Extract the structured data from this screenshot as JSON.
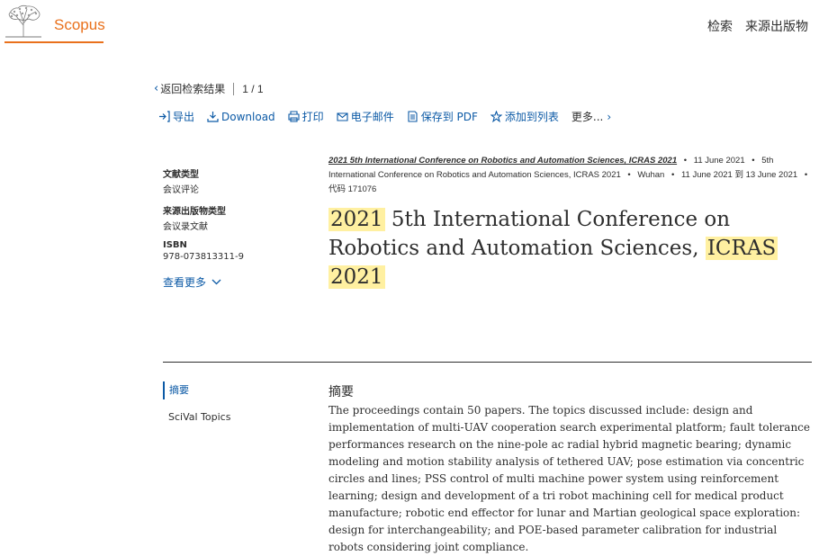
{
  "header": {
    "logo_text": "Scopus",
    "nav": [
      "检索",
      "来源出版物"
    ]
  },
  "colors": {
    "brand": "#e9711c",
    "link": "#0c5aa6",
    "highlight": "#fff0a1"
  },
  "back": {
    "label": "返回检索结果",
    "pager": "1 / 1"
  },
  "toolbar": {
    "export": "导出",
    "download": "Download",
    "print": "打印",
    "email": "电子邮件",
    "save_pdf": "保存到 PDF",
    "add_list": "添加到列表",
    "more": "更多..."
  },
  "meta": {
    "doc_type_label": "文献类型",
    "doc_type_value": "会议评论",
    "source_type_label": "来源出版物类型",
    "source_type_value": "会议录文献",
    "isbn_label": "ISBN",
    "isbn_value": "978-073813311-9",
    "view_more": "查看更多"
  },
  "source": {
    "journal": "2021 5th International Conference on Robotics and Automation Sciences, ICRAS 2021",
    "date": "11 June 2021",
    "conference": "5th International Conference on Robotics and Automation Sciences, ICRAS 2021",
    "location": "Wuhan",
    "date_range": "11 June 2021 到 13 June 2021",
    "code": "代码 171076"
  },
  "title": {
    "part1": "2021",
    "part2": " 5th International Conference on Robotics and Automation Sciences, ",
    "part3": "ICRAS",
    "part4": " ",
    "part5": "2021"
  },
  "sidenav": [
    "摘要",
    "SciVal Topics"
  ],
  "abstract": {
    "heading": "摘要",
    "text": "The proceedings contain 50 papers. The topics discussed include: design and implementation of multi-UAV cooperation search experimental platform; fault tolerance performances research on the nine-pole ac radial hybrid magnetic bearing; dynamic modeling and motion stability analysis of tethered UAV; pose estimation via concentric circles and lines; PSS control of multi machine power system using reinforcement learning; design and development of a tri robot machining cell for medical product manufacture; robotic end effector for lunar and Martian geological space exploration: design for interchangeability; and POE-based parameter calibration for industrial robots considering joint compliance."
  }
}
